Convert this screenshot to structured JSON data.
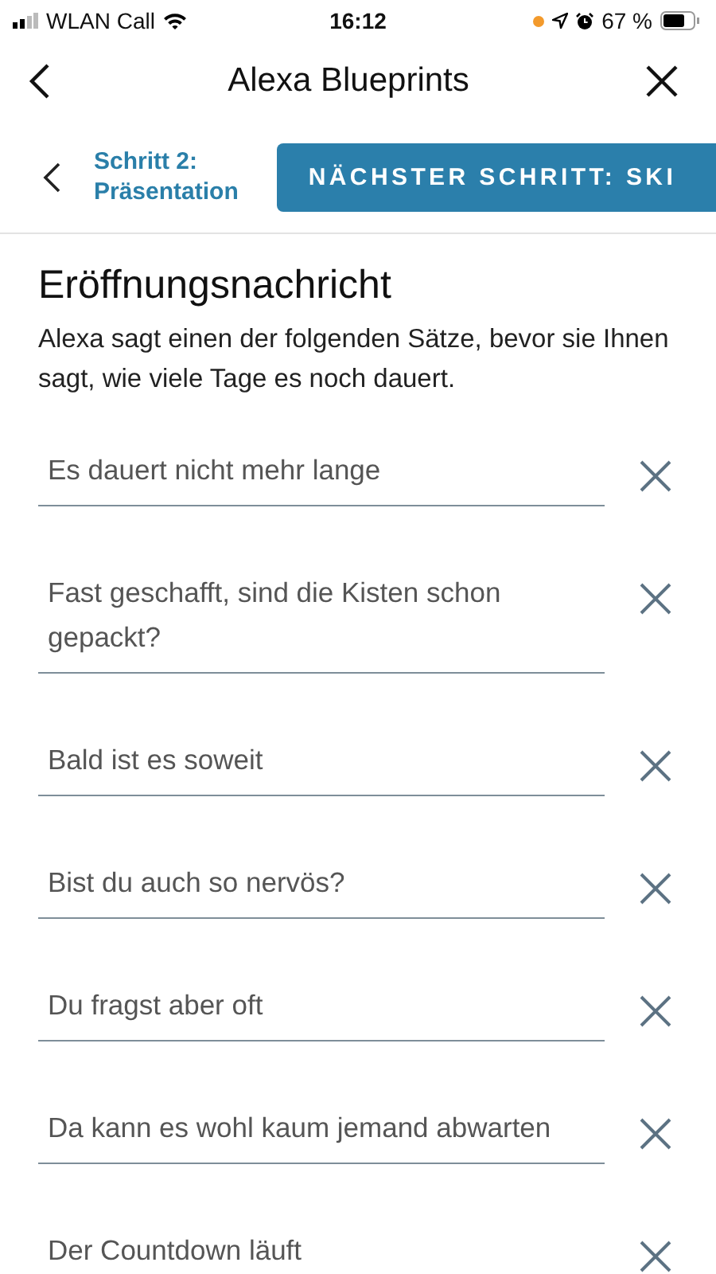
{
  "status_bar": {
    "carrier": "WLAN Call",
    "time": "16:12",
    "battery": "67 %"
  },
  "nav": {
    "title": "Alexa Blueprints"
  },
  "step": {
    "back_label": "Schritt 2:\nPräsentation",
    "next_button": "NÄCHSTER SCHRITT: SKI"
  },
  "section": {
    "heading": "Eröffnungsnachricht",
    "description": "Alexa sagt einen der folgenden Sätze, bevor sie Ihnen sagt, wie viele Tage es noch dauert."
  },
  "phrases": [
    {
      "value": "Es dauert nicht mehr lange"
    },
    {
      "value": "Fast geschafft, sind die Kisten schon gepackt?"
    },
    {
      "value": "Bald ist es soweit"
    },
    {
      "value": "Bist du auch so nervös?"
    },
    {
      "value": "Du fragst aber oft"
    },
    {
      "value": "Da kann es wohl kaum jemand abwarten"
    },
    {
      "value": "Der Countdown läuft"
    }
  ]
}
